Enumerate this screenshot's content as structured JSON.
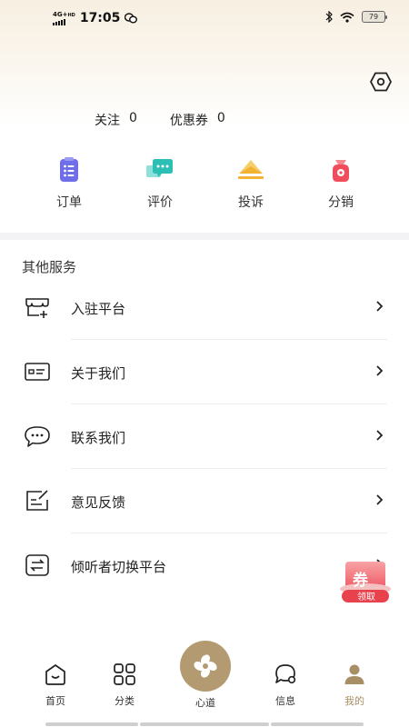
{
  "status_bar": {
    "network": "4G+",
    "hd": "HD",
    "time": "17:05",
    "battery": "79"
  },
  "stats": [
    {
      "label": "关注",
      "value": "0"
    },
    {
      "label": "优惠券",
      "value": "0"
    }
  ],
  "quick_actions": [
    {
      "label": "订单",
      "icon": "order-icon",
      "color": "#6f6ee8"
    },
    {
      "label": "评价",
      "icon": "review-icon",
      "color": "#2bbfb6"
    },
    {
      "label": "投诉",
      "icon": "complaint-icon",
      "color": "#f2b233"
    },
    {
      "label": "分销",
      "icon": "distribution-icon",
      "color": "#ef4d5b"
    }
  ],
  "other_services": {
    "title": "其他服务",
    "items": [
      {
        "label": "入驻平台",
        "icon": "store-icon"
      },
      {
        "label": "关于我们",
        "icon": "id-card-icon"
      },
      {
        "label": "联系我们",
        "icon": "chat-icon"
      },
      {
        "label": "意见反馈",
        "icon": "feedback-icon"
      },
      {
        "label": "倾听者切换平台",
        "icon": "switch-icon"
      }
    ]
  },
  "coupon_float": {
    "char": "券",
    "label": "领取",
    "color": "#ef5a63"
  },
  "tabbar": {
    "items": [
      {
        "label": "首页",
        "icon": "home-icon"
      },
      {
        "label": "分类",
        "icon": "category-icon"
      },
      {
        "label": "心道",
        "icon": "center-logo-icon"
      },
      {
        "label": "信息",
        "icon": "message-icon"
      },
      {
        "label": "我的",
        "icon": "profile-icon",
        "active": true
      }
    ],
    "accent": "#a88e64"
  }
}
